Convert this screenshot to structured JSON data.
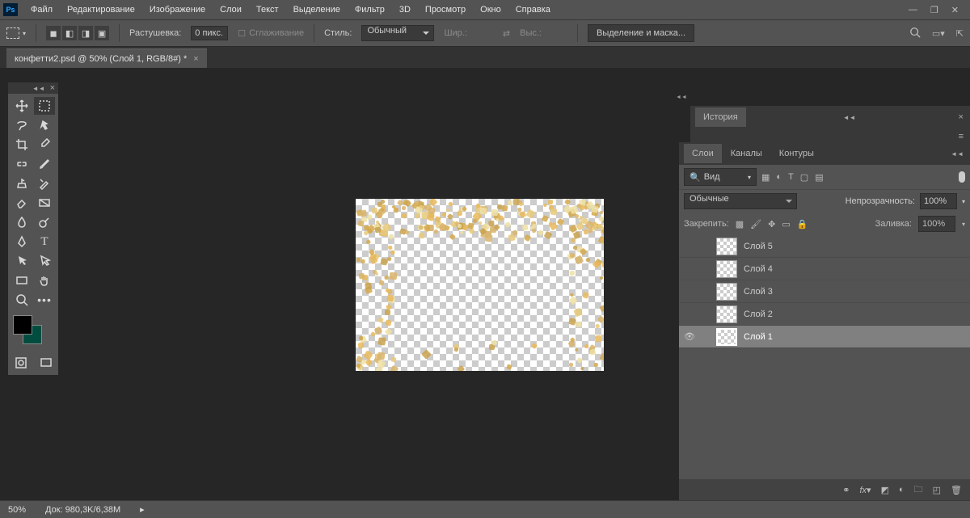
{
  "menu": {
    "file": "Файл",
    "edit": "Редактирование",
    "image": "Изображение",
    "layers": "Слои",
    "type": "Текст",
    "select": "Выделение",
    "filter": "Фильтр",
    "three_d": "3D",
    "view": "Просмотр",
    "window": "Окно",
    "help": "Справка"
  },
  "options": {
    "feather_label": "Растушевка:",
    "feather_value": "0 пикс.",
    "antialias": "Сглаживание",
    "style_label": "Стиль:",
    "style_value": "Обычный",
    "width_label": "Шир.:",
    "height_label": "Выс.:",
    "select_mask": "Выделение и маска..."
  },
  "document": {
    "tab_title": "конфетти2.psd @ 50% (Слой 1, RGB/8#) *"
  },
  "history": {
    "tab": "История"
  },
  "layers_panel": {
    "tab_layers": "Слои",
    "tab_channels": "Каналы",
    "tab_paths": "Контуры",
    "search_placeholder": "Вид",
    "blend_mode": "Обычные",
    "opacity_label": "Непрозрачность:",
    "opacity_value": "100%",
    "lock_label": "Закрепить:",
    "fill_label": "Заливка:",
    "fill_value": "100%",
    "layers": [
      {
        "name": "Слой 5",
        "visible": false,
        "selected": false
      },
      {
        "name": "Слой 4",
        "visible": false,
        "selected": false
      },
      {
        "name": "Слой 3",
        "visible": false,
        "selected": false
      },
      {
        "name": "Слой 2",
        "visible": false,
        "selected": false
      },
      {
        "name": "Слой 1",
        "visible": true,
        "selected": true
      }
    ]
  },
  "status": {
    "zoom": "50%",
    "doc_label": "Док:",
    "doc_size": "980,3K/6,38M"
  }
}
